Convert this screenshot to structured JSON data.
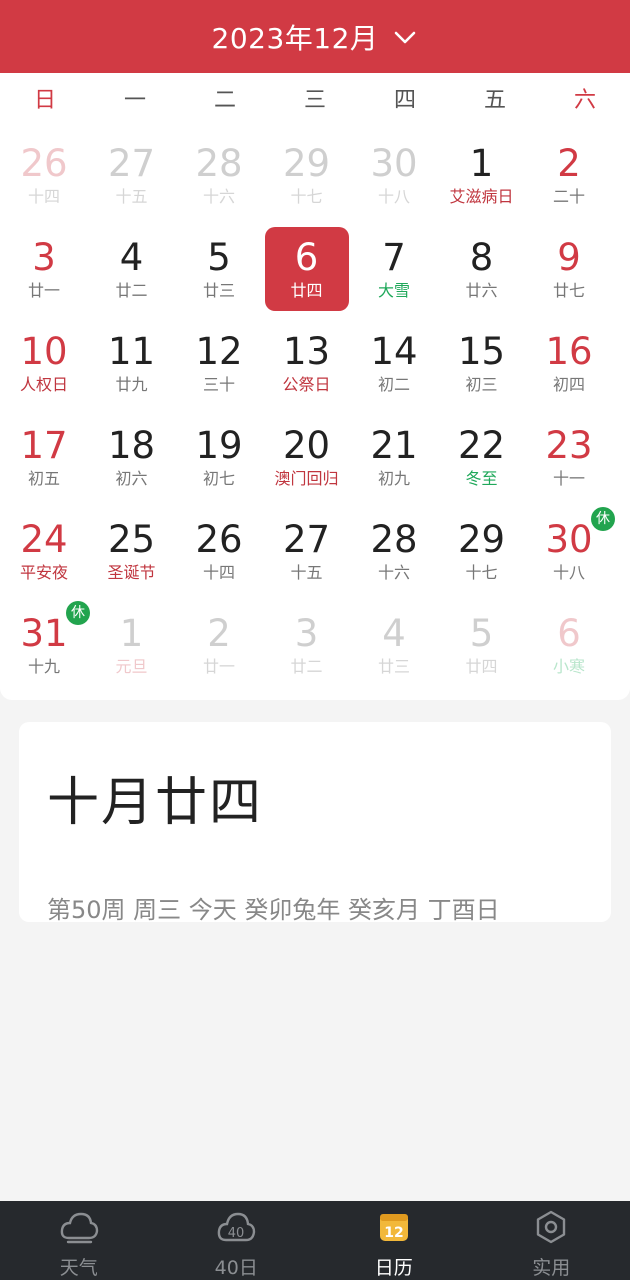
{
  "header": {
    "title": "2023年12月"
  },
  "weekdays": [
    "日",
    "一",
    "二",
    "三",
    "四",
    "五",
    "六"
  ],
  "days": [
    {
      "n": "26",
      "s": "十四",
      "faded": true,
      "weekend": true
    },
    {
      "n": "27",
      "s": "十五",
      "faded": true
    },
    {
      "n": "28",
      "s": "十六",
      "faded": true
    },
    {
      "n": "29",
      "s": "十七",
      "faded": true
    },
    {
      "n": "30",
      "s": "十八",
      "faded": true
    },
    {
      "n": "1",
      "s": "艾滋病日",
      "type": "festival"
    },
    {
      "n": "2",
      "s": "二十",
      "weekend": true
    },
    {
      "n": "3",
      "s": "廿一",
      "weekend": true
    },
    {
      "n": "4",
      "s": "廿二"
    },
    {
      "n": "5",
      "s": "廿三"
    },
    {
      "n": "6",
      "s": "廿四",
      "selected": true
    },
    {
      "n": "7",
      "s": "大雪",
      "type": "term"
    },
    {
      "n": "8",
      "s": "廿六"
    },
    {
      "n": "9",
      "s": "廿七",
      "weekend": true
    },
    {
      "n": "10",
      "s": "人权日",
      "type": "festival",
      "weekend": true
    },
    {
      "n": "11",
      "s": "廿九"
    },
    {
      "n": "12",
      "s": "三十"
    },
    {
      "n": "13",
      "s": "公祭日",
      "type": "festival"
    },
    {
      "n": "14",
      "s": "初二"
    },
    {
      "n": "15",
      "s": "初三"
    },
    {
      "n": "16",
      "s": "初四",
      "weekend": true
    },
    {
      "n": "17",
      "s": "初五",
      "weekend": true
    },
    {
      "n": "18",
      "s": "初六"
    },
    {
      "n": "19",
      "s": "初七"
    },
    {
      "n": "20",
      "s": "澳门回归",
      "type": "festival"
    },
    {
      "n": "21",
      "s": "初九"
    },
    {
      "n": "22",
      "s": "冬至",
      "type": "term"
    },
    {
      "n": "23",
      "s": "十一",
      "weekend": true
    },
    {
      "n": "24",
      "s": "平安夜",
      "type": "festival",
      "weekend": true
    },
    {
      "n": "25",
      "s": "圣诞节",
      "type": "festival"
    },
    {
      "n": "26",
      "s": "十四"
    },
    {
      "n": "27",
      "s": "十五"
    },
    {
      "n": "28",
      "s": "十六"
    },
    {
      "n": "29",
      "s": "十七"
    },
    {
      "n": "30",
      "s": "十八",
      "weekend": true,
      "badge": "休"
    },
    {
      "n": "31",
      "s": "十九",
      "weekend": true,
      "badge": "休"
    },
    {
      "n": "1",
      "s": "元旦",
      "type": "festival",
      "faded": true
    },
    {
      "n": "2",
      "s": "廿一",
      "faded": true
    },
    {
      "n": "3",
      "s": "廿二",
      "faded": true
    },
    {
      "n": "4",
      "s": "廿三",
      "faded": true
    },
    {
      "n": "5",
      "s": "廿四",
      "faded": true
    },
    {
      "n": "6",
      "s": "小寒",
      "type": "term",
      "faded": true,
      "weekend": true
    }
  ],
  "info": {
    "lunar_date": "十月廿四",
    "detail": "第50周 周三 今天 癸卯兔年 癸亥月 丁酉日"
  },
  "nav": [
    {
      "label": "天气",
      "icon": "cloud-icon"
    },
    {
      "label": "40日",
      "icon": "forty-day-icon",
      "icon_text": "40"
    },
    {
      "label": "日历",
      "icon": "calendar-icon",
      "icon_text": "12",
      "active": true
    },
    {
      "label": "实用",
      "icon": "tools-icon"
    }
  ],
  "colors": {
    "accent": "#d13a44",
    "term": "#1fa85a",
    "badge": "#22a44e",
    "nav_bg": "#26292d"
  }
}
